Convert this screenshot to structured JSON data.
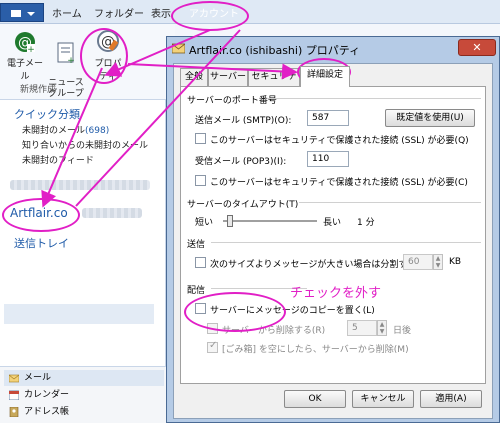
{
  "ribbon": {
    "tabs": [
      "ホーム",
      "フォルダー",
      "表示",
      "アカウント"
    ],
    "buttons": [
      {
        "label": "電子メール",
        "icon": "new-email-icon"
      },
      {
        "label": "ニュース\nグループ",
        "icon": "newsgroup-icon"
      },
      {
        "label": "プロパティ",
        "icon": "properties-icon"
      }
    ],
    "group_label": "新規作成"
  },
  "nav": {
    "quick_heading": "クイック分類",
    "quick_items": [
      {
        "label": "未開封のメール",
        "count": "(698)"
      },
      {
        "label": "知り合いからの未開封のメール"
      },
      {
        "label": "未開封のフィード"
      }
    ],
    "account": "Artflair.co",
    "outbox": "送信トレイ",
    "bottom": [
      {
        "label": "メール",
        "icon": "mail-icon"
      },
      {
        "label": "カレンダー",
        "icon": "calendar-icon"
      },
      {
        "label": "アドレス帳",
        "icon": "address-book-icon"
      }
    ]
  },
  "dialog": {
    "title": "Artflair.co (ishibashi) プロパティ",
    "close_label": "✕",
    "tabs": [
      "全般",
      "サーバー",
      "セキュリティ",
      "詳細設定"
    ],
    "active_tab": "詳細設定",
    "ports_heading": "サーバーのポート番号",
    "smtp_label": "送信メール (SMTP)(O):",
    "smtp_value": "587",
    "default_button": "既定値を使用(U)",
    "ssl_smtp_label": "このサーバーはセキュリティで保護された接続 (SSL) が必要(Q)",
    "pop3_label": "受信メール (POP3)(I):",
    "pop3_value": "110",
    "ssl_pop3_label": "このサーバーはセキュリティで保護された接続 (SSL) が必要(C)",
    "timeout_heading": "サーバーのタイムアウト(T)",
    "timeout_short": "短い",
    "timeout_long": "長い",
    "timeout_value": "1 分",
    "timeout_level": 0.05,
    "send_heading": "送信",
    "split_label": "次のサイズよりメッセージが大きい場合は分割する(B)",
    "split_value": "60",
    "split_unit": "KB",
    "delivery_heading": "配信",
    "leave_copy_label": "サーバーにメッセージのコピーを置く(L)",
    "remove_after_label": "サーバーから削除する(R)",
    "remove_after_value": "5",
    "remove_after_unit": "日後",
    "remove_deleted_label": "[ごみ箱] を空にしたら、サーバーから削除(M)",
    "ok": "OK",
    "cancel": "キャンセル",
    "apply": "適用(A)"
  },
  "annotation": {
    "text": "チェックを外す",
    "color": "#e11fc6"
  }
}
